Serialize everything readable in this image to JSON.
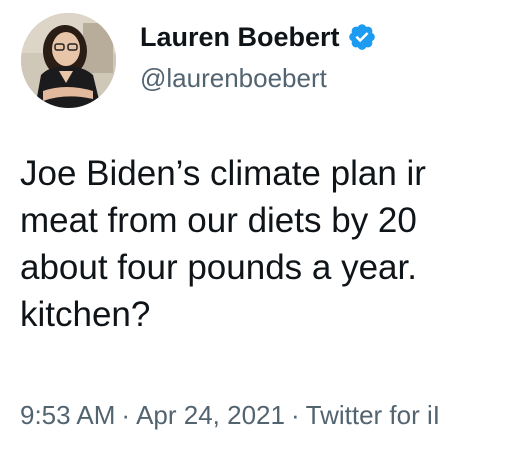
{
  "author": {
    "display_name": "Lauren Boebert",
    "handle": "@laurenboebert",
    "verified_icon": "verified-badge-icon",
    "verified_color": "#1d9bf0"
  },
  "tweet": {
    "lines": [
      "Joe Biden’s climate plan ir",
      "meat from our diets by 20",
      "about four pounds a year.",
      "kitchen?"
    ]
  },
  "meta": {
    "time": "9:53 AM",
    "separator": "·",
    "date": "Apr 24, 2021",
    "client": "Twitter for iI"
  }
}
